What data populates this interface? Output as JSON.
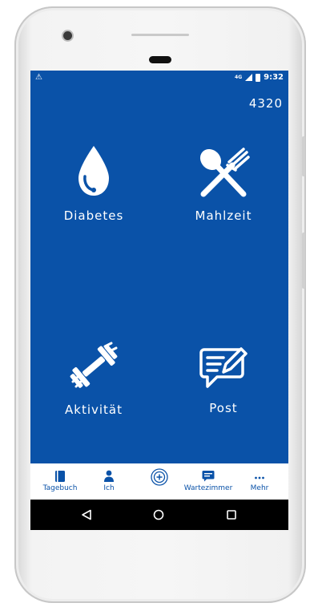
{
  "status": {
    "warning": "⚠",
    "network": "4G",
    "time": "9:32"
  },
  "points": "4320",
  "tiles": [
    {
      "label": "Diabetes",
      "icon": "drop-icon"
    },
    {
      "label": "Mahlzeit",
      "icon": "fork-spoon-icon"
    },
    {
      "label": "Aktivität",
      "icon": "dumbbell-icon"
    },
    {
      "label": "Post",
      "icon": "message-icon"
    }
  ],
  "nav": {
    "items": [
      {
        "label": "Tagebuch",
        "icon": "book-icon"
      },
      {
        "label": "Ich",
        "icon": "person-icon"
      },
      {
        "label": "",
        "icon": "add-circle-icon"
      },
      {
        "label": "Wartezimmer",
        "icon": "chat-icon"
      },
      {
        "label": "Mehr",
        "icon": "more-icon"
      }
    ]
  },
  "colors": {
    "primary": "#0a52a8",
    "nav_bg": "#ffffff",
    "system_bar": "#000000"
  }
}
